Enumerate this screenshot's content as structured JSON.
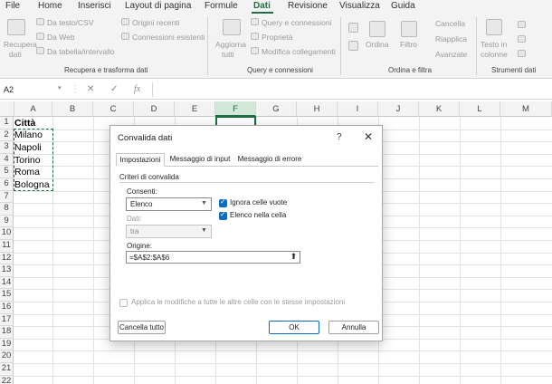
{
  "menu": [
    "File",
    "Home",
    "Inserisci",
    "Layout di pagina",
    "Formule",
    "Dati",
    "Revisione",
    "Visualizza",
    "Guida"
  ],
  "ribbon": {
    "recupera": "Recupera",
    "dati": "dati",
    "da_testo": "Da testo/CSV",
    "da_web": "Da Web",
    "da_tabella": "Da tabella/intervallo",
    "origini_recenti": "Origini recenti",
    "connessioni": "Connessioni esistenti",
    "group_recupera": "Recupera e trasforma dati",
    "aggiorna": "Aggiorna",
    "tutti": "tutti",
    "query_conn": "Query e connessioni",
    "proprieta": "Proprietà",
    "modifica_coll": "Modifica collegamenti",
    "group_query": "Query e connessioni",
    "ordina": "Ordina",
    "filtro": "Filtro",
    "cancella": "Cancella",
    "riapplica": "Riapplica",
    "avanzate": "Avanzate",
    "group_ordina": "Ordina e filtra",
    "testo_in": "Testo in",
    "colonne": "colonne",
    "group_strumenti": "Strumenti dati"
  },
  "formula_bar": {
    "name_box": "A2",
    "cancel": "✕",
    "enter": "✓",
    "fx": "fx",
    "value": ""
  },
  "columns": [
    "A",
    "B",
    "C",
    "D",
    "E",
    "F",
    "G",
    "H",
    "I",
    "J",
    "K",
    "L",
    "M"
  ],
  "rows": [
    "1",
    "2",
    "3",
    "4",
    "5",
    "6",
    "7",
    "8",
    "9",
    "10",
    "11",
    "12",
    "13",
    "14",
    "15",
    "16",
    "17",
    "18",
    "19",
    "20",
    "21",
    "22"
  ],
  "cells": [
    "Città",
    "Milano",
    "Napoli",
    "Torino",
    "Roma",
    "Bologna"
  ],
  "dialog": {
    "title": "Convalida dati",
    "help": "?",
    "close": "✕",
    "tabs": [
      "Impostazioni",
      "Messaggio di input",
      "Messaggio di errore"
    ],
    "section": "Criteri di convalida",
    "consenti_label": "Consenti:",
    "consenti_value": "Elenco",
    "dati_label": "Dati:",
    "dati_value": "tra",
    "ignora": "Ignora celle vuote",
    "elenco_cella": "Elenco nella cella",
    "origine_label": "Origine:",
    "origine_value": "=$A$2:$A$6",
    "applica": "Applica le modifiche a tutte le altre celle con le stesse impostazioni",
    "cancella_tutto": "Cancella tutto",
    "ok": "OK",
    "annulla": "Annulla"
  },
  "colors": {
    "accent": "#1e6e42",
    "check": "#0f6cbd"
  }
}
